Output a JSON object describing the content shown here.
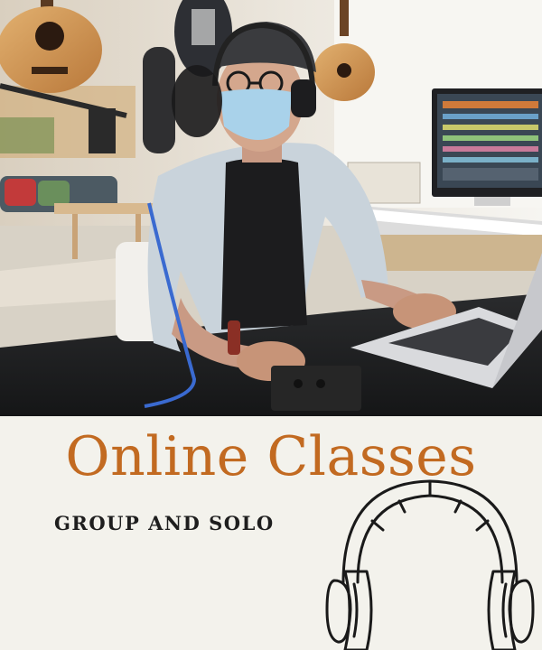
{
  "photo": {
    "subject": "musician-with-headphones-and-mask-at-desk"
  },
  "promo": {
    "headline": "Online Classes",
    "subheadline": "GROUP AND SOLO",
    "icon": "headphones-icon"
  },
  "colors": {
    "headline": "#c26a21",
    "subheadline": "#1e1e1e",
    "panel_background": "#f3f2ec",
    "icon_stroke": "#1a1a1a"
  }
}
